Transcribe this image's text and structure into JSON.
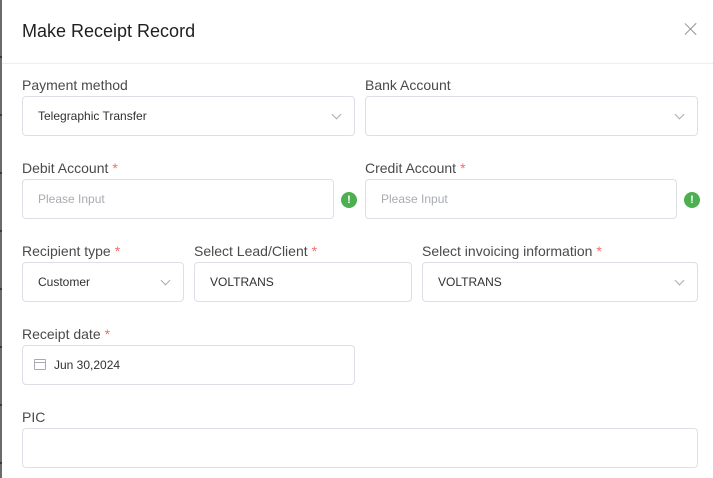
{
  "dialog": {
    "title": "Make Receipt Record"
  },
  "fields": {
    "payment_method": {
      "label": "Payment method",
      "value": "Telegraphic Transfer"
    },
    "bank_account": {
      "label": "Bank Account",
      "value": ""
    },
    "debit_account": {
      "label": "Debit Account",
      "required": "*",
      "placeholder": "Please Input",
      "status_icon": "exclamation-icon"
    },
    "credit_account": {
      "label": "Credit Account",
      "required": "*",
      "placeholder": "Please Input",
      "status_icon": "exclamation-icon"
    },
    "recipient_type": {
      "label": "Recipient type",
      "required": "*",
      "value": "Customer"
    },
    "lead_client": {
      "label": "Select Lead/Client",
      "required": "*",
      "value": "VOLTRANS"
    },
    "invoicing_info": {
      "label": "Select invoicing information",
      "required": "*",
      "value": "VOLTRANS"
    },
    "receipt_date": {
      "label": "Receipt date",
      "required": "*",
      "value": "Jun 30,2024"
    },
    "pic": {
      "label": "PIC",
      "value": ""
    }
  },
  "icons": {
    "warn_glyph": "!",
    "close": "close-icon",
    "calendar": "calendar-icon",
    "chevron": "chevron-down-icon"
  },
  "colors": {
    "required": "#f56c6c",
    "warning_badge": "#4caf50",
    "border": "#dcdfe6"
  }
}
